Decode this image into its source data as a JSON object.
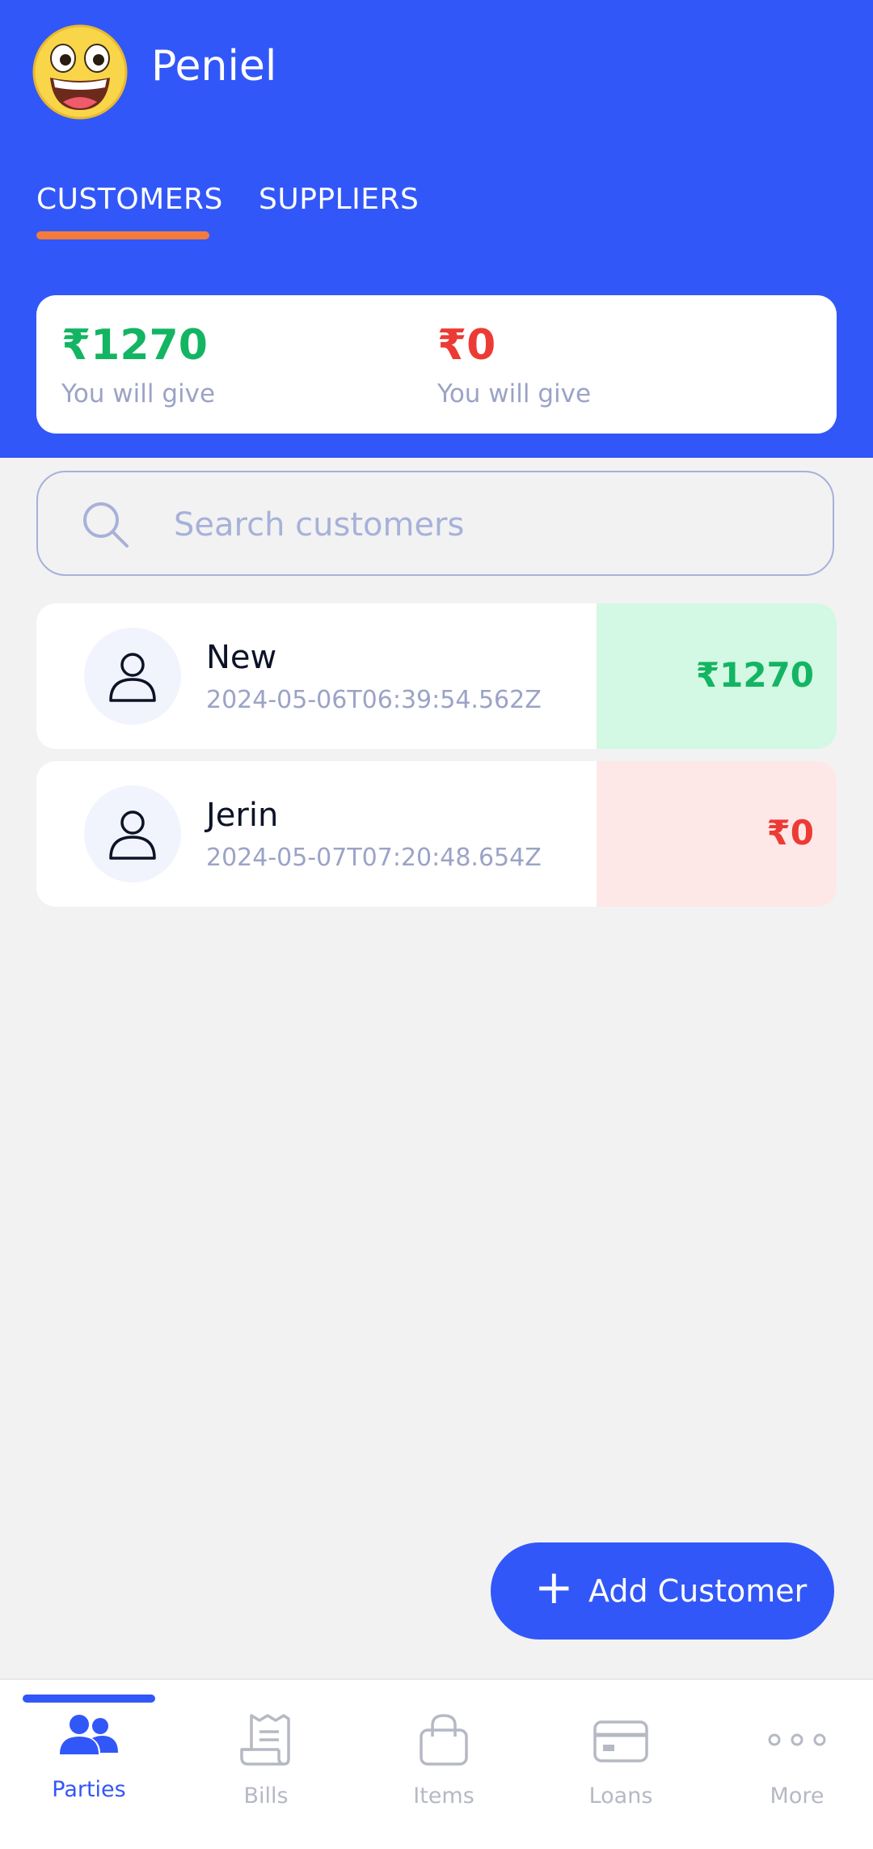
{
  "header": {
    "user_name": "Peniel",
    "tabs": [
      {
        "label": "CUSTOMERS",
        "active": true
      },
      {
        "label": "SUPPLIERS",
        "active": false
      }
    ]
  },
  "summary": {
    "left": {
      "amount": "₹1270",
      "label": "You will give",
      "color": "#13b562"
    },
    "right": {
      "amount": "₹0",
      "label": "You will give",
      "color": "#ec3b34"
    }
  },
  "search": {
    "placeholder": "Search customers",
    "value": ""
  },
  "customers": [
    {
      "name": "New",
      "date": "2024-05-06T06:39:54.562Z",
      "amount": "₹1270",
      "status": "positive"
    },
    {
      "name": "Jerin",
      "date": "2024-05-07T07:20:48.654Z",
      "amount": "₹0",
      "status": "zero"
    }
  ],
  "fab": {
    "icon": "plus-icon",
    "label": "Add Customer"
  },
  "bottom_nav": [
    {
      "label": "Parties",
      "icon": "users-icon",
      "active": true
    },
    {
      "label": "Bills",
      "icon": "receipt-icon",
      "active": false
    },
    {
      "label": "Items",
      "icon": "shopping-bag-icon",
      "active": false
    },
    {
      "label": "Loans",
      "icon": "credit-card-icon",
      "active": false
    },
    {
      "label": "More",
      "icon": "more-dots-icon",
      "active": false
    }
  ],
  "colors": {
    "primary": "#3257f8",
    "tab_indicator": "#f47b3b",
    "positive": "#13b562",
    "negative": "#ec3b34"
  }
}
